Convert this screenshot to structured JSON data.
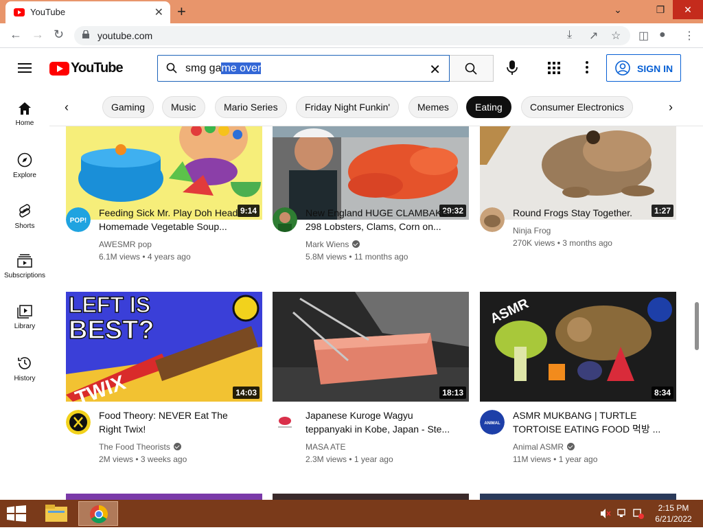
{
  "browser": {
    "tab_title": "YouTube",
    "tab_close": "✕",
    "new_tab": "+",
    "url": "youtube.com",
    "window_controls": {
      "minimize": "⌄",
      "restore": "❐",
      "close": "✕"
    }
  },
  "header": {
    "logo_text": "YouTube",
    "search_query_prefix": "smg ga",
    "search_query_selected": "me over",
    "signin_label": "SIGN IN"
  },
  "chips": [
    "Gaming",
    "Music",
    "Mario Series",
    "Friday Night Funkin'",
    "Memes",
    "Eating",
    "Consumer Electronics"
  ],
  "active_chip": "Eating",
  "guide": {
    "items": [
      {
        "label": "Home",
        "icon": "home-icon"
      },
      {
        "label": "Explore",
        "icon": "compass-icon"
      },
      {
        "label": "Shorts",
        "icon": "shorts-icon"
      },
      {
        "label": "Subscriptions",
        "icon": "subscriptions-icon"
      },
      {
        "label": "Library",
        "icon": "library-icon"
      },
      {
        "label": "History",
        "icon": "history-icon"
      }
    ]
  },
  "videos": [
    {
      "title_1": "Feeding Sick Mr. Play Doh Head",
      "title_2": "Homemade Vegetable Soup...",
      "channel": "AWESMR pop",
      "verified": false,
      "views": "6.1M views",
      "age": "4 years ago",
      "duration": "9:14",
      "avatar_text": "POP!"
    },
    {
      "title_1": "New England HUGE CLAMBAKE!!",
      "title_2": "298 Lobsters, Clams, Corn on...",
      "channel": "Mark Wiens",
      "verified": true,
      "views": "5.8M views",
      "age": "11 months ago",
      "duration": "29:32"
    },
    {
      "title_1": "Round Frogs Stay Together.",
      "title_2": "",
      "channel": "Ninja Frog",
      "verified": false,
      "views": "270K views",
      "age": "3 months ago",
      "duration": "1:27"
    },
    {
      "title_1": "Food Theory: NEVER Eat The",
      "title_2": "Right Twix!",
      "channel": "The Food Theorists",
      "verified": true,
      "views": "2M views",
      "age": "3 weeks ago",
      "duration": "14:03",
      "thumb_text_1": "LEFT IS",
      "thumb_text_2": "BEST?",
      "thumb_brand": "TWIX"
    },
    {
      "title_1": "Japanese Kuroge Wagyu",
      "title_2": "teppanyaki in Kobe, Japan - Ste...",
      "channel": "MASA ATE",
      "verified": false,
      "views": "2.3M views",
      "age": "1 year ago",
      "duration": "18:13"
    },
    {
      "title_1": "ASMR MUKBANG | TURTLE",
      "title_2": "TORTOISE EATING FOOD 먹방 ...",
      "channel": "Animal ASMR",
      "verified": true,
      "views": "11M views",
      "age": "1 year ago",
      "duration": "8:34",
      "thumb_text_1": "ASMR",
      "avatar_text": "ANIMAL"
    }
  ],
  "meta_separator": "•",
  "taskbar": {
    "time": "2:15 PM",
    "date": "6/21/2022"
  }
}
